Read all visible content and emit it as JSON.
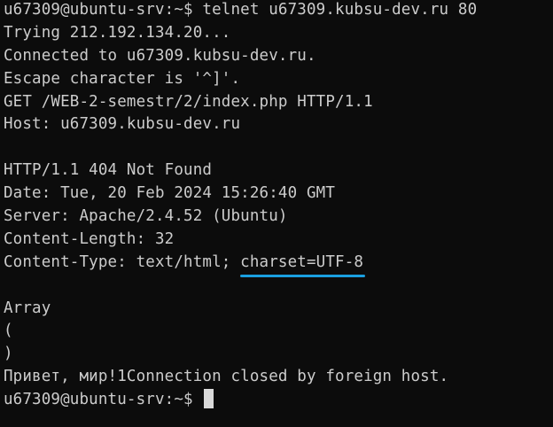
{
  "colors": {
    "background": "#0c0c0c",
    "foreground": "#cccccc",
    "underline": "#1a9fe0",
    "cursor": "#d9d9d9"
  },
  "terminal": {
    "command_line": "u67309@ubuntu-srv:~$ telnet u67309.kubsu-dev.ru 80",
    "lines": [
      "Trying 212.192.134.20...",
      "Connected to u67309.kubsu-dev.ru.",
      "Escape character is '^]'.",
      "GET /WEB-2-semestr/2/index.php HTTP/1.1",
      "Host: u67309.kubsu-dev.ru",
      "",
      "HTTP/1.1 404 Not Found",
      "Date: Tue, 20 Feb 2024 15:26:40 GMT",
      "Server: Apache/2.4.52 (Ubuntu)",
      "Content-Length: 32"
    ],
    "content_type_prefix": "Content-Type: text/html; ",
    "content_type_charset": "charset=UTF-8",
    "lines_after": [
      "",
      "Array",
      "(",
      ")",
      "Привет, мир!1Connection closed by foreign host."
    ],
    "prompt": "u67309@ubuntu-srv:~$ "
  }
}
